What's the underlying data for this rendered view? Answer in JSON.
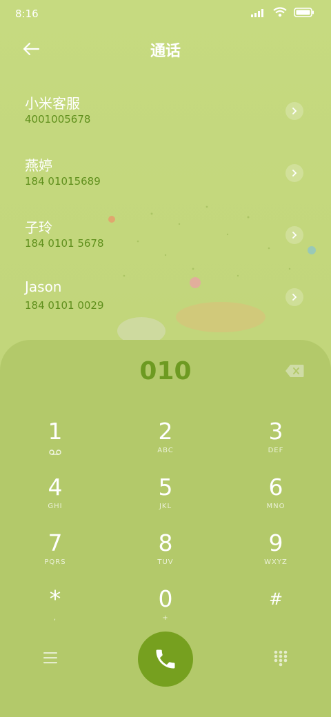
{
  "status_bar": {
    "time": "8:16",
    "signal_icon": "signal-bars-icon",
    "wifi_icon": "wifi-icon",
    "battery_icon": "battery-icon"
  },
  "header": {
    "title": "通话",
    "back_icon": "arrow-left-icon"
  },
  "contacts": [
    {
      "name": "小米客服",
      "number": "4001005678"
    },
    {
      "name": "燕婷",
      "number": "184 01015689"
    },
    {
      "name": "子玲",
      "number": "184 0101 5678"
    },
    {
      "name": "Jason",
      "number": "184 0101 0029"
    }
  ],
  "dialer": {
    "input": "010",
    "keys": [
      {
        "main": "1",
        "sub": "voicemail-icon"
      },
      {
        "main": "2",
        "sub": "ABC"
      },
      {
        "main": "3",
        "sub": "DEF"
      },
      {
        "main": "4",
        "sub": "GHI"
      },
      {
        "main": "5",
        "sub": "JKL"
      },
      {
        "main": "6",
        "sub": "MNO"
      },
      {
        "main": "7",
        "sub": "PQRS"
      },
      {
        "main": "8",
        "sub": "TUV"
      },
      {
        "main": "9",
        "sub": "WXYZ"
      },
      {
        "main": "*",
        "sub": ","
      },
      {
        "main": "0",
        "sub": "+"
      },
      {
        "main": "#",
        "sub": ""
      }
    ]
  },
  "colors": {
    "accent": "#76a01f",
    "number_text": "#5f8f1c",
    "panel": "#b3c96a",
    "background": "#c4d97e"
  }
}
